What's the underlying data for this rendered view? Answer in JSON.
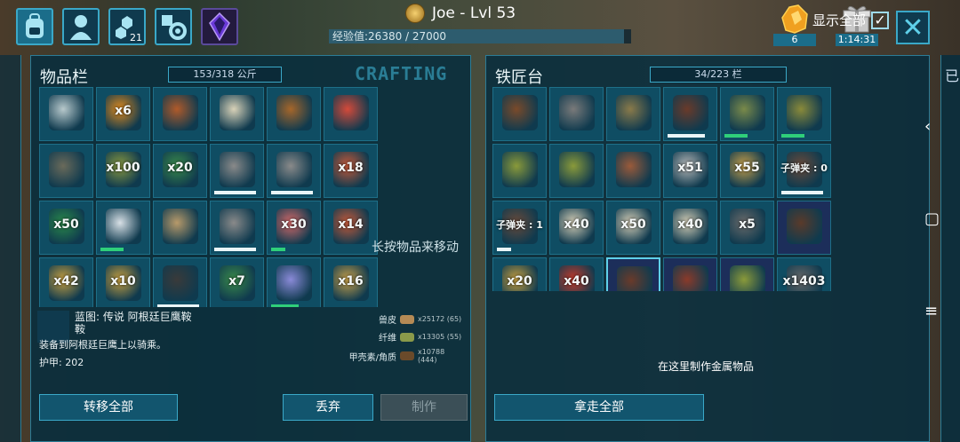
{
  "topbar": {
    "buttons": [
      {
        "icon": "backpack-icon",
        "count": ""
      },
      {
        "icon": "character-icon",
        "count": ""
      },
      {
        "icon": "engrams-icon",
        "count": "21"
      },
      {
        "icon": "settings-icon",
        "count": ""
      },
      {
        "icon": "crystal-icon",
        "count": ""
      }
    ],
    "player_name": "Joe - Lvl 53",
    "xp_text": "经验值:26380 / 27000",
    "xp_fraction": 0.977,
    "amber_count": "6",
    "gift_timer": "1:14:31",
    "close_icon": "close-icon"
  },
  "inventory": {
    "title": "物品栏",
    "weight": "153/318 公斤",
    "crafting_label": "CRAFTING",
    "rows": [
      [
        {
          "qty": "",
          "color": "#b8c9cc"
        },
        {
          "qty": "x6",
          "color": "#e08a1e"
        },
        {
          "qty": "",
          "color": "#b05a2a"
        },
        {
          "qty": "",
          "color": "#d9d2b8"
        },
        {
          "qty": "",
          "color": "#a6662a"
        },
        {
          "qty": "",
          "color": "#d44a3a"
        }
      ],
      [
        {
          "qty": "",
          "color": "#6a6a5a"
        },
        {
          "qty": "x100",
          "color": "#8a9a40"
        },
        {
          "qty": "x20",
          "color": "#3a8a4a"
        },
        {
          "qty": "",
          "color": "#8a8a8a",
          "dur": 0.9
        },
        {
          "qty": "",
          "color": "#8a8a8a",
          "dur": 0.9
        },
        {
          "qty": "x18",
          "color": "#c85a3a"
        }
      ],
      [
        {
          "qty": "x50",
          "color": "#2a8a4a"
        },
        {
          "qty": "",
          "color": "#d8e0e6",
          "durg": 0.5
        },
        {
          "qty": "",
          "color": "#b89a6a"
        },
        {
          "qty": "",
          "color": "#8a8a8a",
          "dur": 0.9
        },
        {
          "qty": "x30",
          "color": "#d86a6a",
          "durg": 0.3
        },
        {
          "qty": "x14",
          "color": "#c85a3a"
        }
      ],
      [
        {
          "qty": "x42",
          "color": "#c8a040"
        },
        {
          "qty": "x10",
          "color": "#c8a040"
        },
        {
          "qty": "",
          "color": "#3a3a3a",
          "dur": 0.9
        },
        {
          "qty": "x7",
          "color": "#3a8a4a"
        },
        {
          "qty": "",
          "color": "#8a8ad8",
          "durg": 0.6
        },
        {
          "qty": "x16",
          "color": "#c8a04a"
        }
      ]
    ],
    "hint": "长按物品来移动",
    "selected": {
      "title": "蓝图: 传说 阿根廷巨鹰鞍",
      "subtitle": "鞍",
      "description": "装备到阿根廷巨鹰上以骑乘。",
      "armor": "护甲: 202",
      "requirements": [
        {
          "name": "兽皮",
          "value": "x25172 (65)"
        },
        {
          "name": "纤维",
          "value": "x13305 (55)"
        },
        {
          "name": "甲壳素/角质",
          "value": "x10788 (444)"
        }
      ]
    },
    "buttons": {
      "transfer_all": "转移全部",
      "drop": "丢弃",
      "craft": "制作"
    }
  },
  "smithy": {
    "title": "铁匠台",
    "capacity": "34/223 栏",
    "show_all_label": "显示全部",
    "show_all_checked": "✓",
    "rows": [
      [
        {
          "qty": "",
          "color": "#7a4a2a"
        },
        {
          "qty": "",
          "color": "#7a7a7a"
        },
        {
          "qty": "",
          "color": "#8a7a4a"
        },
        {
          "qty": "",
          "color": "#6a3a2a",
          "dur": 0.8
        },
        {
          "qty": "",
          "color": "#7a8a4a",
          "durg": 0.5
        },
        {
          "qty": "",
          "color": "#8a8a3a",
          "durg": 0.5
        }
      ],
      [
        {
          "qty": "",
          "color": "#8a9a3a"
        },
        {
          "qty": "",
          "color": "#8a9a3a"
        },
        {
          "qty": "",
          "color": "#9a5a3a"
        },
        {
          "qty": "x51",
          "color": "#b8b8b8"
        },
        {
          "qty": "x55",
          "color": "#c8a04a"
        },
        {
          "qty": "子弹夹 : 0",
          "color": "#6a4a3a",
          "dur": 0.9
        }
      ],
      [
        {
          "qty": "子弹夹 : 1",
          "color": "#6a4a3a",
          "dur": 0.3
        },
        {
          "qty": "x40",
          "color": "#d8d0b8"
        },
        {
          "qty": "x50",
          "color": "#d8d0b8"
        },
        {
          "qty": "x40",
          "color": "#d8d0b8"
        },
        {
          "qty": "x5",
          "color": "#6a6a6a"
        },
        {
          "qty": "",
          "color": "#5a3a2a",
          "bp": true
        }
      ],
      [
        {
          "qty": "x20",
          "color": "#c8a040"
        },
        {
          "qty": "x40",
          "color": "#c83a2a"
        },
        {
          "qty": "",
          "color": "#6a3a2a",
          "bp": true,
          "sel": true
        },
        {
          "qty": "",
          "color": "#8a3a2a",
          "bp": true
        },
        {
          "qty": "",
          "color": "#8a9a3a",
          "bp": true
        },
        {
          "qty": "x1403",
          "color": "#6a6a6a"
        }
      ]
    ],
    "empty_text": "在这里制作金属物品",
    "take_all": "拿走全部"
  },
  "right_panel": {
    "label": "已"
  },
  "nav": {
    "back": "‹",
    "home": "▢",
    "menu": "≡"
  }
}
